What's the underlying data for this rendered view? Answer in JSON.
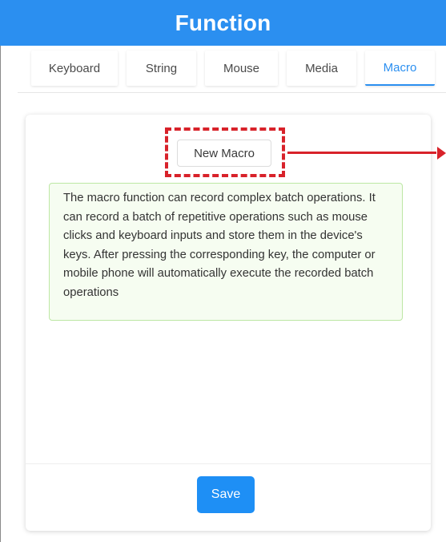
{
  "header": {
    "title": "Function"
  },
  "tabs": [
    {
      "label": "Keyboard",
      "active": false
    },
    {
      "label": "String",
      "active": false
    },
    {
      "label": "Mouse",
      "active": false
    },
    {
      "label": "Media",
      "active": false
    },
    {
      "label": "Macro",
      "active": true
    }
  ],
  "macro": {
    "new_macro_label": "New Macro",
    "info_text": "The macro function can record complex batch operations. It can record a batch of repetitive operations such as mouse clicks and keyboard inputs and store them in the device's keys. After pressing the corresponding key, the computer or mobile phone will automatically execute the recorded batch operations",
    "save_label": "Save"
  },
  "colors": {
    "header_bg": "#2b8ff0",
    "accent": "#2b8ff0",
    "annotation": "#d8222a",
    "info_bg": "#f6fdf1",
    "info_border": "#bde7a4",
    "save_bg": "#1e8ff5"
  }
}
